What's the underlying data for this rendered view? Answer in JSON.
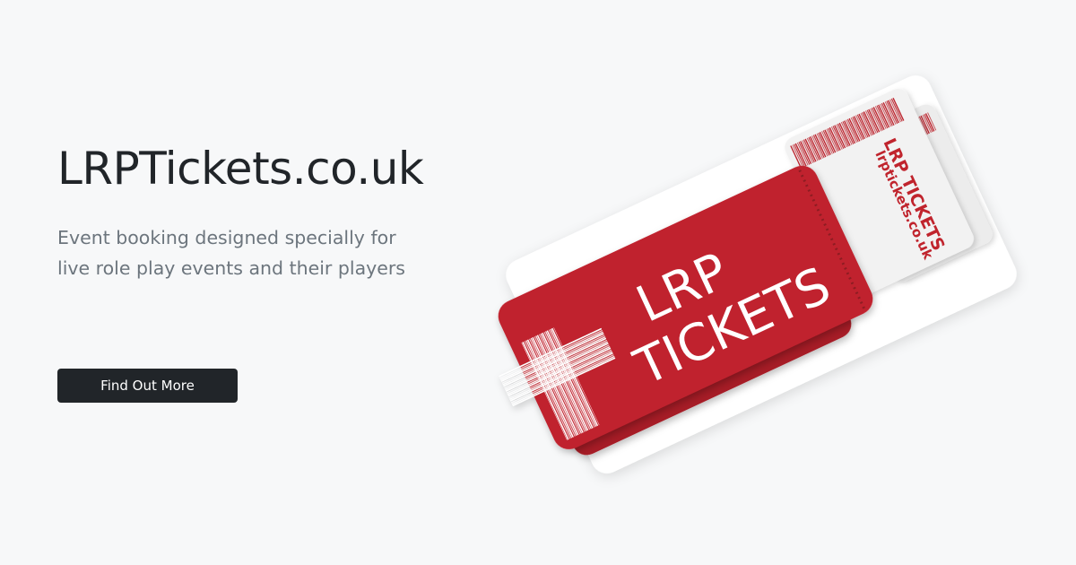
{
  "hero": {
    "title": "LRPTickets.co.uk",
    "subtitle": "Event booking designed specially for live role play events and their players",
    "cta_label": "Find Out More"
  },
  "illustration": {
    "main_ticket_line1": "LRP",
    "main_ticket_line2": "TICKETS",
    "stub_title": "LRP TICKETS",
    "stub_url": "lrptickets.co.uk"
  },
  "colors": {
    "background": "#f7f8f9",
    "text_dark": "#212529",
    "text_muted": "#6c757d",
    "button": "#212529",
    "ticket_red": "#c0242d",
    "ticket_red_dark": "#a61e26",
    "stub_paper": "#f2f2f2"
  }
}
